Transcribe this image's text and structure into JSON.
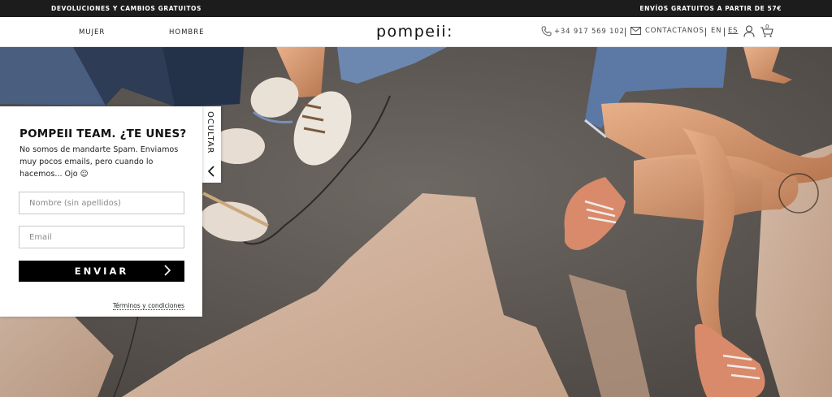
{
  "topbar": {
    "returns": "DEVOLUCIONES Y CAMBIOS GRATUITOS",
    "shipping": "ENVÍOS GRATUITOS A PARTIR DE 57€"
  },
  "header": {
    "nav": [
      "MUJER",
      "HOMBRE"
    ],
    "logo": "pompeii:",
    "phone": "+34 917 569 102",
    "contact": "CONTACTANOS",
    "lang_en": "EN",
    "lang_es": "ES",
    "cart_count": "0"
  },
  "popup": {
    "title": "POMPEII TEAM. ¿TE UNES?",
    "body": "No somos de mandarte Spam. Enviamos muy pocos emails, pero cuando lo hacemos... Ojo ☺",
    "name_placeholder": "Nombre (sin apellidos)",
    "email_placeholder": "Email",
    "submit": "ENVIAR",
    "terms": "Términos y condiciones",
    "hide": "OCULTAR"
  },
  "colors": {
    "topbar_bg": "#1c1c1c",
    "asphalt": "#5f5a55",
    "sun": "#d9b9a3"
  }
}
